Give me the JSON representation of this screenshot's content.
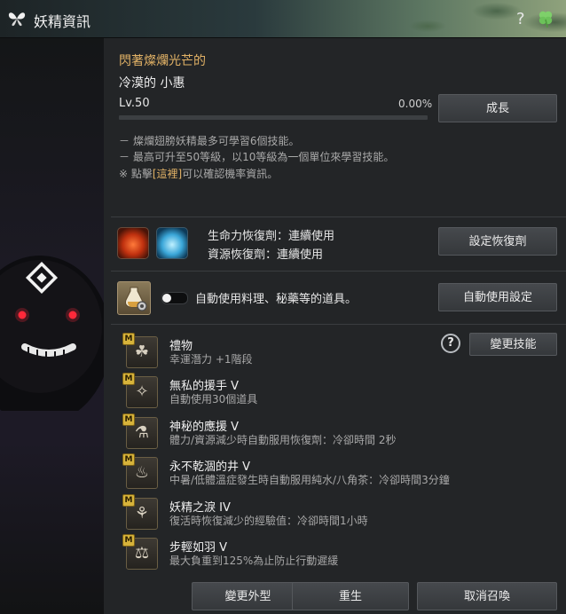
{
  "window": {
    "title": "妖精資訊",
    "help_glyph": "?"
  },
  "fairy": {
    "status": "閃著燦爛光芒的",
    "name": "冷漠的 小惠",
    "level": "Lv.50",
    "progress_text": "0.00%",
    "progress_fraction": 0.0,
    "grow_button": "成長"
  },
  "notes": {
    "line1": "－ 燦爛翅膀妖精最多可學習6個技能。",
    "line2": "－ 最高可升至50等級，以10等級為一個單位來學習技能。",
    "line3_prefix": "※ 點擊",
    "line3_link": "[這裡]",
    "line3_suffix": "可以確認機率資訊。"
  },
  "recovery": {
    "hp_label": "生命力恢復劑：連續使用",
    "mp_label": "資源恢復劑：連續使用",
    "set_button": "設定恢復劑"
  },
  "auto_use": {
    "label": "自動使用料理、秘藥等的道具。",
    "enabled": false,
    "settings_button": "自動使用設定"
  },
  "skills_header": {
    "help_glyph": "?",
    "change_button": "變更技能"
  },
  "skills": [
    {
      "badge": "M",
      "name": "禮物",
      "desc": "幸運潛力 +1階段",
      "icon": "clover-icon"
    },
    {
      "badge": "M",
      "name": "無私的援手 V",
      "desc": "自動使用30個道具",
      "icon": "fairy-hand-icon"
    },
    {
      "badge": "M",
      "name": "神秘的應援 V",
      "desc": "體力/資源減少時自動服用恢復劑：冷卻時間 2秒",
      "icon": "potion-cheer-icon"
    },
    {
      "badge": "M",
      "name": "永不乾涸的井 V",
      "desc": "中暑/低體溫症發生時自動服用純水/八角茶：冷卻時間3分鐘",
      "icon": "well-bowl-icon"
    },
    {
      "badge": "M",
      "name": "妖精之淚 IV",
      "desc": "復活時恢復減少的經驗值：冷卻時間1小時",
      "icon": "sprout-tear-icon"
    },
    {
      "badge": "M",
      "name": "步輕如羽 V",
      "desc": "最大負重到125%為止防止行動遲緩",
      "icon": "feather-bag-icon"
    }
  ],
  "footer": {
    "appearance_button": "變更外型",
    "rebirth_button": "重生",
    "dismiss_button": "取消召喚"
  },
  "colors": {
    "accent_gold": "#e2b266",
    "panel_bg": "#232527",
    "button_bg": "#3d4043"
  }
}
